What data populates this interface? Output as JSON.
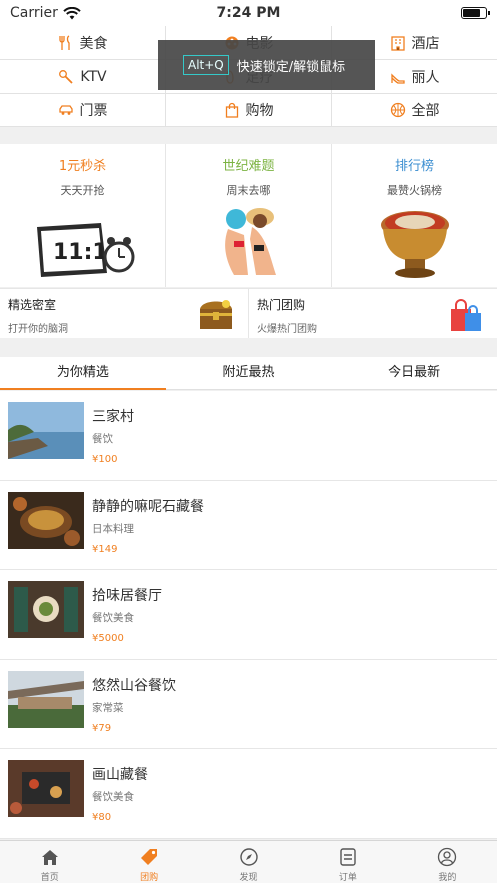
{
  "status_bar": {
    "carrier": "Carrier",
    "time": "7:24 PM"
  },
  "categories": [
    [
      {
        "label": "美食",
        "icon": "fork-knife-icon",
        "color": "#f07f20"
      },
      {
        "label": "电影",
        "icon": "film-reel-icon",
        "color": "#f07f20"
      },
      {
        "label": "酒店",
        "icon": "hotel-icon",
        "color": "#f07f20"
      }
    ],
    [
      {
        "label": "KTV",
        "icon": "microphone-icon",
        "color": "#f07f20"
      },
      {
        "label": "足疗",
        "icon": "foot-icon",
        "color": "#f07f20"
      },
      {
        "label": "丽人",
        "icon": "high-heel-icon",
        "color": "#f07f20"
      }
    ],
    [
      {
        "label": "门票",
        "icon": "car-icon",
        "color": "#f07f20"
      },
      {
        "label": "购物",
        "icon": "shopping-bag-icon",
        "color": "#f07f20"
      },
      {
        "label": "全部",
        "icon": "ball-icon",
        "color": "#f07f20"
      }
    ]
  ],
  "tooltip": {
    "key": "Alt+Q",
    "text": "快速锁定/解锁鼠标"
  },
  "promos": [
    {
      "title": "1元秒杀",
      "subtitle": "天天开抢",
      "color": "#f07f20",
      "pic": "calendar-clock-image"
    },
    {
      "title": "世纪难题",
      "subtitle": "周末去哪",
      "color": "#7cb342",
      "pic": "beach-couple-image"
    },
    {
      "title": "排行榜",
      "subtitle": "最赞火锅榜",
      "color": "#3d8fd1",
      "pic": "hotpot-image"
    }
  ],
  "specials": [
    {
      "title": "精选密室",
      "subtitle": "打开你的脑洞",
      "pic": "treasure-chest-image"
    },
    {
      "title": "热门团购",
      "subtitle": "火爆热门团购",
      "pic": "shopping-bags-image"
    }
  ],
  "tabs": [
    "为你精选",
    "附近最热",
    "今日最新"
  ],
  "deals": [
    {
      "name": "三家村",
      "category": "餐饮",
      "price": "¥100"
    },
    {
      "name": "静静的嘛呢石藏餐",
      "category": "日本料理",
      "price": "¥149"
    },
    {
      "name": "拾味居餐厅",
      "category": "餐饮美食",
      "price": "¥5000"
    },
    {
      "name": "悠然山谷餐饮",
      "category": "家常菜",
      "price": "¥79"
    },
    {
      "name": "画山藏餐",
      "category": "餐饮美食",
      "price": "¥80"
    }
  ],
  "tabbar": [
    {
      "label": "首页",
      "icon": "home-icon",
      "active": false
    },
    {
      "label": "团购",
      "icon": "tag-icon",
      "active": true
    },
    {
      "label": "发现",
      "icon": "compass-icon",
      "active": false
    },
    {
      "label": "订单",
      "icon": "order-icon",
      "active": false
    },
    {
      "label": "我的",
      "icon": "user-icon",
      "active": false
    }
  ],
  "colors": {
    "accent": "#f07f20",
    "tooltip_border": "#35c9c9"
  }
}
